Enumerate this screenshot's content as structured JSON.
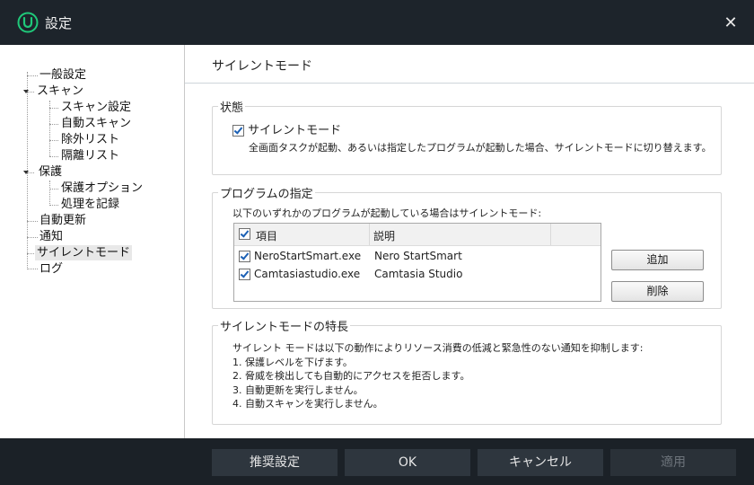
{
  "window": {
    "title": "設定",
    "close_glyph": "✕"
  },
  "sidebar": {
    "items": [
      {
        "label": "一般設定"
      },
      {
        "label": "スキャン"
      },
      {
        "label": "スキャン設定"
      },
      {
        "label": "自動スキャン"
      },
      {
        "label": "除外リスト"
      },
      {
        "label": "隔離リスト"
      },
      {
        "label": "保護"
      },
      {
        "label": "保護オプション"
      },
      {
        "label": "処理を記録"
      },
      {
        "label": "自動更新"
      },
      {
        "label": "通知"
      },
      {
        "label": "サイレントモード"
      },
      {
        "label": "ログ"
      }
    ],
    "selected": "サイレントモード"
  },
  "content": {
    "title": "サイレントモード",
    "status_group": {
      "label": "状態",
      "checkbox_label": "サイレントモード",
      "checked": true,
      "description": "全画面タスクが起動、あるいは指定したプログラムが起動した場合、サイレントモードに切り替えます。"
    },
    "programs_group": {
      "label": "プログラムの指定",
      "intro": "以下のいずれかのプログラムが起動している場合はサイレントモード:",
      "columns": [
        "項目",
        "説明"
      ],
      "rows": [
        {
          "name": "NeroStartSmart.exe",
          "desc": "Nero StartSmart",
          "checked": true
        },
        {
          "name": "Camtasiastudio.exe",
          "desc": "Camtasia Studio",
          "checked": true
        }
      ],
      "add_label": "追加",
      "delete_label": "削除"
    },
    "features_group": {
      "label": "サイレントモードの特長",
      "lines": [
        "サイレント モードは以下の動作によりリソース消費の低減と緊急性のない通知を抑制します:",
        "1. 保護レベルを下げます。",
        "2. 脅威を検出しても自動的にアクセスを拒否します。",
        "3. 自動更新を実行しません。",
        "4. 自動スキャンを実行しません。"
      ]
    }
  },
  "footer": {
    "recommended_label": "推奨設定",
    "ok_label": "OK",
    "cancel_label": "キャンセル",
    "apply_label": "適用"
  },
  "colors": {
    "accent": "#1fc97a",
    "titlebar": "#1d242b",
    "footer": "#1b2127"
  }
}
